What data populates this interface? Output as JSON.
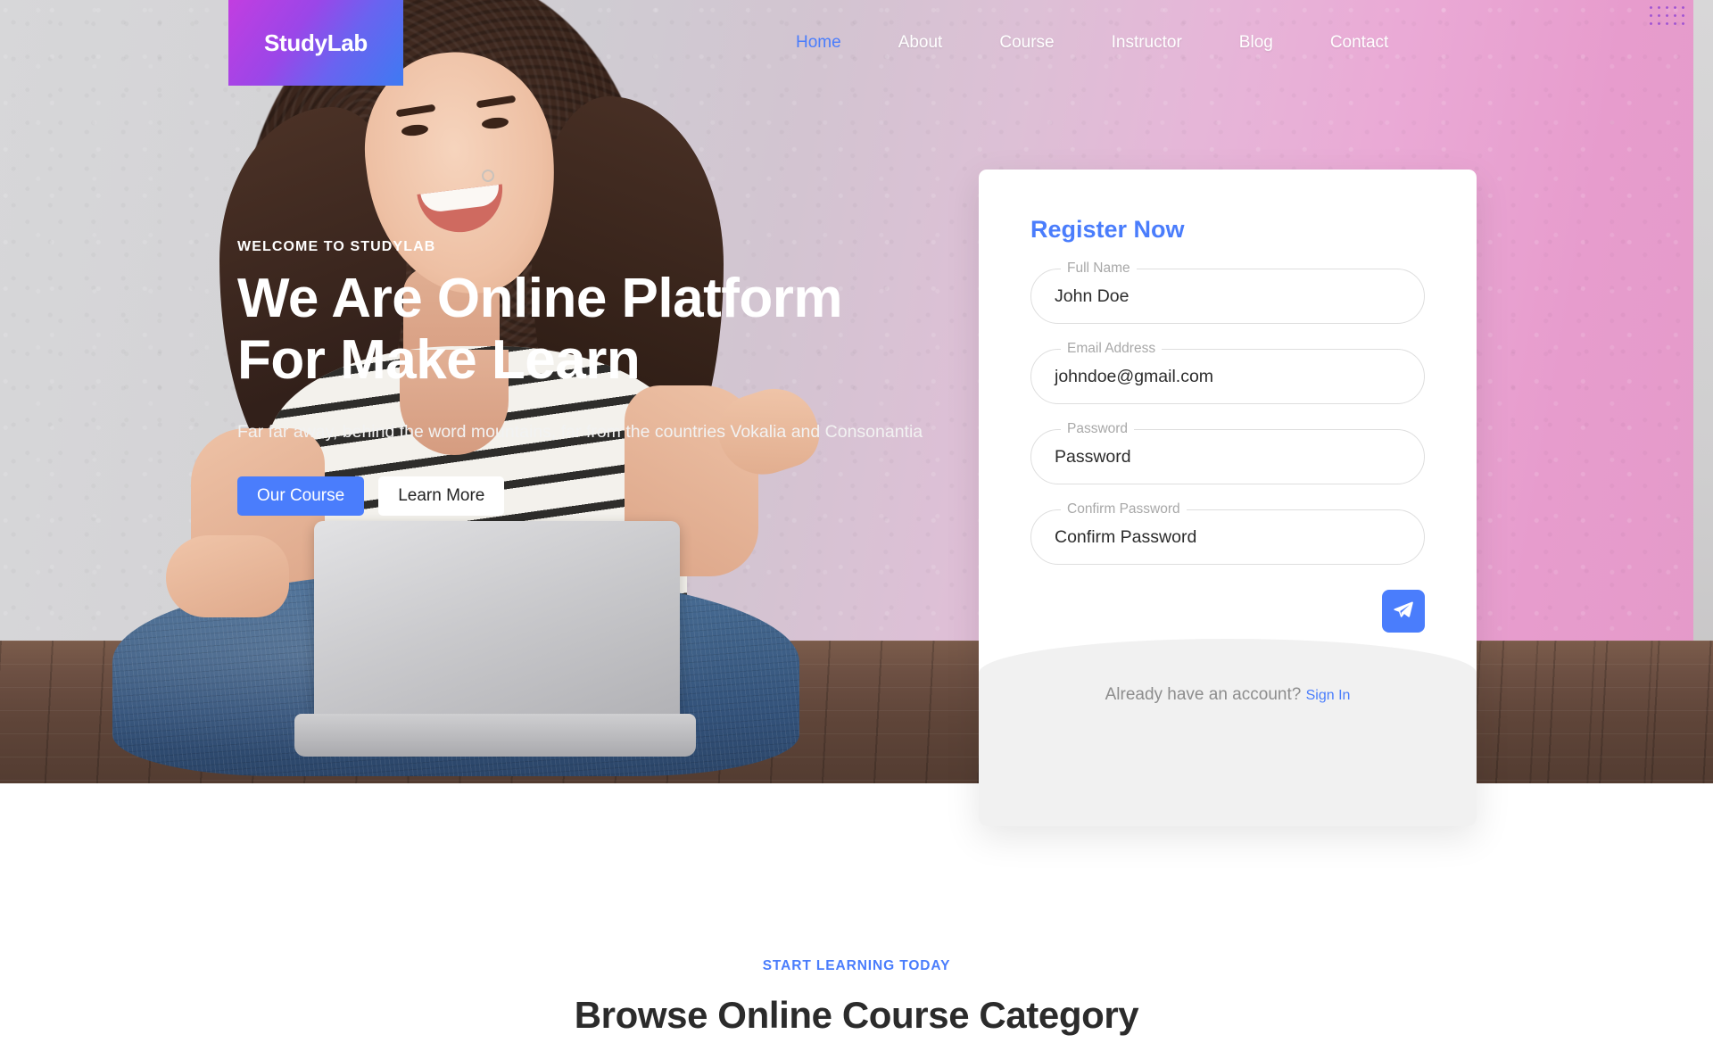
{
  "header": {
    "logo_text": "StudyLab",
    "nav": [
      {
        "label": "Home",
        "active": true
      },
      {
        "label": "About",
        "active": false
      },
      {
        "label": "Course",
        "active": false
      },
      {
        "label": "Instructor",
        "active": false
      },
      {
        "label": "Blog",
        "active": false
      },
      {
        "label": "Contact",
        "active": false
      }
    ]
  },
  "hero": {
    "eyebrow": "WELCOME TO STUDYLAB",
    "title_line1": "We Are Online Platform",
    "title_line2": "For Make Learn",
    "subtitle": "Far far away, behind the word mountains, far from the countries Vokalia and Consonantia",
    "primary_button": "Our Course",
    "secondary_button": "Learn More"
  },
  "register_card": {
    "title": "Register Now",
    "fields": [
      {
        "label": "Full Name",
        "value": "John Doe"
      },
      {
        "label": "Email Address",
        "value": "johndoe@gmail.com"
      },
      {
        "label": "Password",
        "value": "Password"
      },
      {
        "label": "Confirm Password",
        "value": "Confirm Password"
      }
    ],
    "submit_icon": "send-icon",
    "footer_text": "Already have an account? ",
    "footer_link": "Sign In"
  },
  "category_section": {
    "eyebrow": "START LEARNING TODAY",
    "title": "Browse Online Course Category"
  },
  "colors": {
    "accent_blue": "#4a7dfc",
    "logo_gradient_start": "#c23ee0",
    "logo_gradient_end": "#3e7af2",
    "card_footer_bg": "#f1f1f1",
    "heading_dark": "#2b2b2b"
  }
}
